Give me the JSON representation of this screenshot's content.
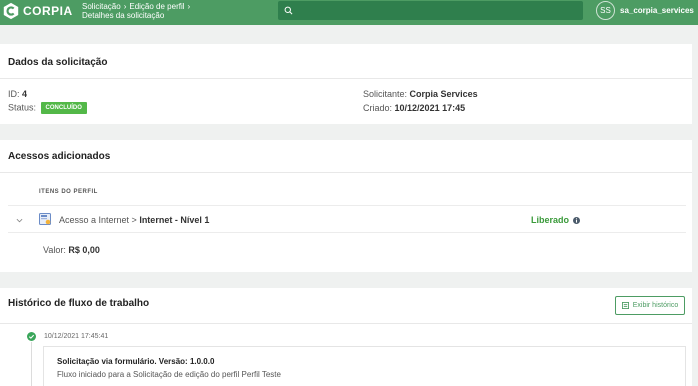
{
  "header": {
    "logo_text": "CORPIA",
    "breadcrumb": {
      "item1": "Solicitação",
      "item2": "Edição de perfil",
      "current": "Detalhes da solicitação"
    },
    "search": {
      "placeholder": ""
    },
    "user": {
      "initials": "SS",
      "name": "sa_corpia_services"
    },
    "colors": {
      "header_bg": "#4d9c63",
      "search_bg": "#2f7f4d"
    }
  },
  "request_data": {
    "title": "Dados da solicitação",
    "id_label": "ID:",
    "id_value": "4",
    "status_label": "Status:",
    "status_value": "CONCLUÍDO",
    "requester_label": "Solicitante:",
    "requester_value": "Corpia Services",
    "created_label": "Criado:",
    "created_value": "10/12/2021 17:45"
  },
  "added_access": {
    "title": "Acessos adicionados",
    "column_header": "ITENS DO PERFIL",
    "items": [
      {
        "path": "Acesso a Internet >",
        "name": "Internet - Nível 1",
        "status": "Liberado",
        "status_color": "#3a9a3a"
      }
    ],
    "value_label": "Valor:",
    "value_amount": "R$ 0,00"
  },
  "workflow": {
    "title": "Histórico de fluxo de trabalho",
    "history_button": "Exibir histórico",
    "entries": [
      {
        "timestamp": "10/12/2021 17:45:41",
        "title": "Solicitação via formulário. Versão: 1.0.0.0",
        "description": "Fluxo iniciado para a Solicitação de edição do perfil Perfil Teste"
      }
    ]
  }
}
